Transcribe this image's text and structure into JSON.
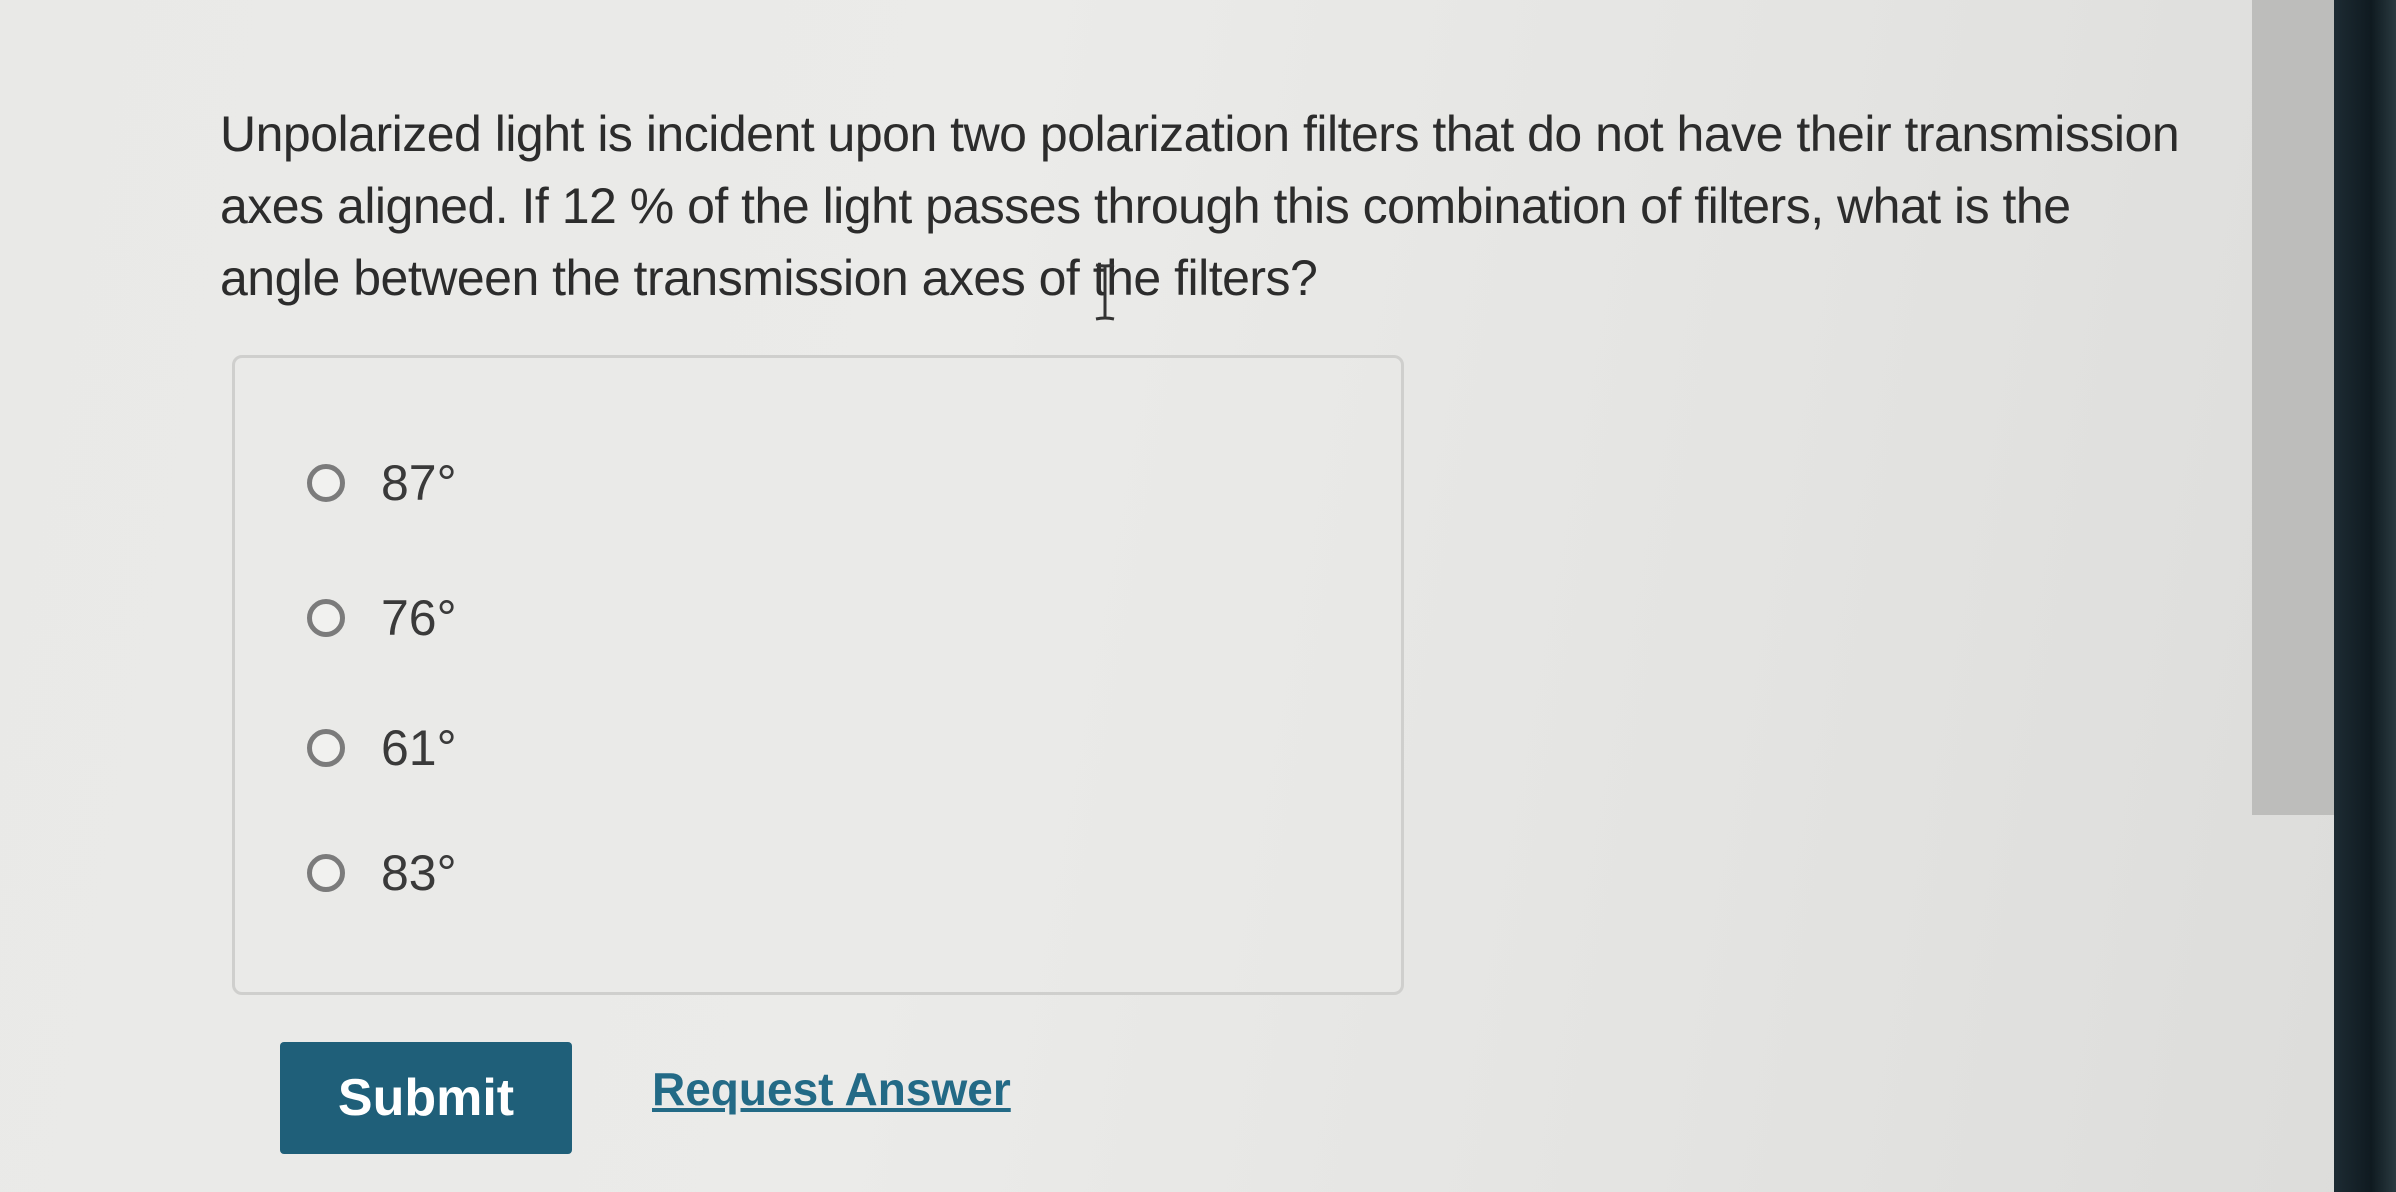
{
  "question": {
    "text": "Unpolarized light is incident upon two polarization filters that do not have their transmission axes aligned. If 12 % of the light passes through this combination of filters, what is the angle between the transmission axes of the filters?"
  },
  "options": [
    {
      "label": "87°"
    },
    {
      "label": "76°"
    },
    {
      "label": "61°"
    },
    {
      "label": "83°"
    }
  ],
  "actions": {
    "submit_label": "Submit",
    "request_answer_label": "Request Answer"
  },
  "colors": {
    "submit_bg": "#1f5f79",
    "link": "#236a86",
    "text": "#2c2c2c"
  },
  "icons": {
    "cursor": "text-cursor-icon",
    "radio": "radio-unselected-icon"
  }
}
